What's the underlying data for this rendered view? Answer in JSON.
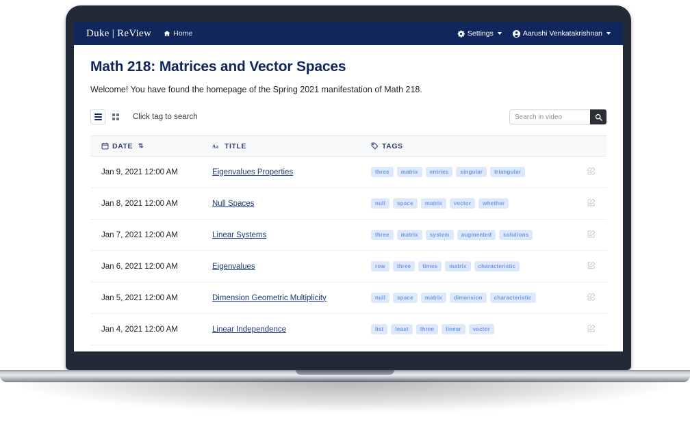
{
  "navbar": {
    "brand": "Duke | ReView",
    "home_label": "Home",
    "home_icon": "home-icon",
    "settings_label": "Settings",
    "settings_icon": "gear-icon",
    "user_label": "Aarushi Venkatakrishnan",
    "user_icon": "user-circle-icon",
    "background_color": "#12265e"
  },
  "page": {
    "title": "Math 218: Matrices and Vector Spaces",
    "title_color": "#12265e",
    "welcome": "Welcome! You have found the homepage of the Spring 2021 manifestation of Math 218."
  },
  "toolbar": {
    "list_view_icon": "list-view-icon",
    "grid_view_icon": "grid-view-icon",
    "hint": "Click tag to search",
    "search_placeholder": "Search in video",
    "search_value": "",
    "search_icon": "search-icon",
    "search_button_color": "#2c3036"
  },
  "table": {
    "columns": [
      {
        "label": "DATE",
        "icon": "calendar-icon",
        "sort": "⇅"
      },
      {
        "label": "TITLE",
        "icon": "text-aa-icon"
      },
      {
        "label": "TAGS",
        "icon": "tag-icon"
      }
    ],
    "row_action_icon": "edit-icon",
    "tag_color": "#6d9beb",
    "tag_background": "#dde8fb",
    "rows": [
      {
        "date": "Jan 9, 2021 12:00 AM",
        "title": "Eigenvalues Properties",
        "tags": [
          "three",
          "matrix",
          "entries",
          "singular",
          "triangular"
        ]
      },
      {
        "date": "Jan 8, 2021 12:00 AM",
        "title": "Null Spaces",
        "tags": [
          "null",
          "space",
          "matrix",
          "vector",
          "whether"
        ]
      },
      {
        "date": "Jan 7, 2021 12:00 AM",
        "title": "Linear Systems",
        "tags": [
          "three",
          "matrix",
          "system",
          "augmented",
          "solutions"
        ]
      },
      {
        "date": "Jan 6, 2021 12:00 AM",
        "title": "Eigenvalues",
        "tags": [
          "row",
          "three",
          "times",
          "matrix",
          "characteristic"
        ]
      },
      {
        "date": "Jan 5, 2021 12:00 AM",
        "title": "Dimension Geometric Multiplicity",
        "tags": [
          "null",
          "space",
          "matrix",
          "dimension",
          "characteristic"
        ]
      },
      {
        "date": "Jan 4, 2021 12:00 AM",
        "title": "Linear Independence",
        "tags": [
          "list",
          "least",
          "three",
          "linear",
          "vector"
        ]
      }
    ]
  }
}
